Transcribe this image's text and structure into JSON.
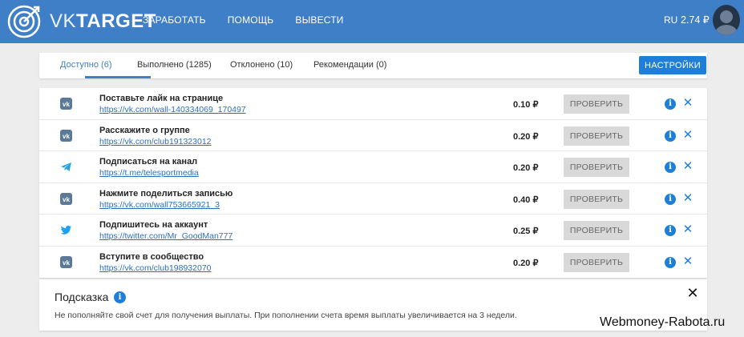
{
  "header": {
    "logo": {
      "part1": "VK",
      "part2": "TARGET"
    },
    "nav": [
      "ЗАРАБОТАТЬ",
      "ПОМОЩЬ",
      "ВЫВЕСТИ"
    ],
    "lang": "RU",
    "balance": "2.74 ₽"
  },
  "tabs": [
    {
      "label": "Доступно (6)",
      "active": true
    },
    {
      "label": "Выполнено (1285)",
      "active": false
    },
    {
      "label": "Отклонено (10)",
      "active": false
    },
    {
      "label": "Рекомендации (0)",
      "active": false
    }
  ],
  "settings_label": "НАСТРОЙКИ",
  "tasks": [
    {
      "icon": "vk-icon",
      "title": "Поставьте лайк на странице",
      "link": "https://vk.com/wall-140334069_170497",
      "price": "0.10 ₽",
      "button": "ПРОВЕРИТЬ"
    },
    {
      "icon": "vk-icon",
      "title": "Расскажите о группе",
      "link": "https://vk.com/club191323012",
      "price": "0.20 ₽",
      "button": "ПРОВЕРИТЬ"
    },
    {
      "icon": "telegram-icon",
      "title": "Подписаться на канал",
      "link": "https://t.me/telesportmedia",
      "price": "0.20 ₽",
      "button": "ПРОВЕРИТЬ"
    },
    {
      "icon": "vk-icon",
      "title": "Нажмите поделиться записью",
      "link": "https://vk.com/wall753665921_3",
      "price": "0.40 ₽",
      "button": "ПРОВЕРИТЬ"
    },
    {
      "icon": "twitter-icon",
      "title": "Подпишитесь на аккаунт",
      "link": "https://twitter.com/Mr_GoodMan777",
      "price": "0.25 ₽",
      "button": "ПРОВЕРИТЬ"
    },
    {
      "icon": "vk-icon",
      "title": "Вступите в сообщество",
      "link": "https://vk.com/club198932070",
      "price": "0.20 ₽",
      "button": "ПРОВЕРИТЬ"
    }
  ],
  "hint": {
    "title": "Подсказка",
    "text": "Не пополняйте свой счет для получения выплаты. При пополнении счета время выплаты увеличивается на 3 недели."
  },
  "watermark": "Webmoney-Rabota.ru",
  "colors": {
    "header": "#3f7fc8",
    "accent": "#1f7ed8",
    "vk": "#5b7a99",
    "telegram": "#2aa3df",
    "twitter": "#1da1f2"
  }
}
